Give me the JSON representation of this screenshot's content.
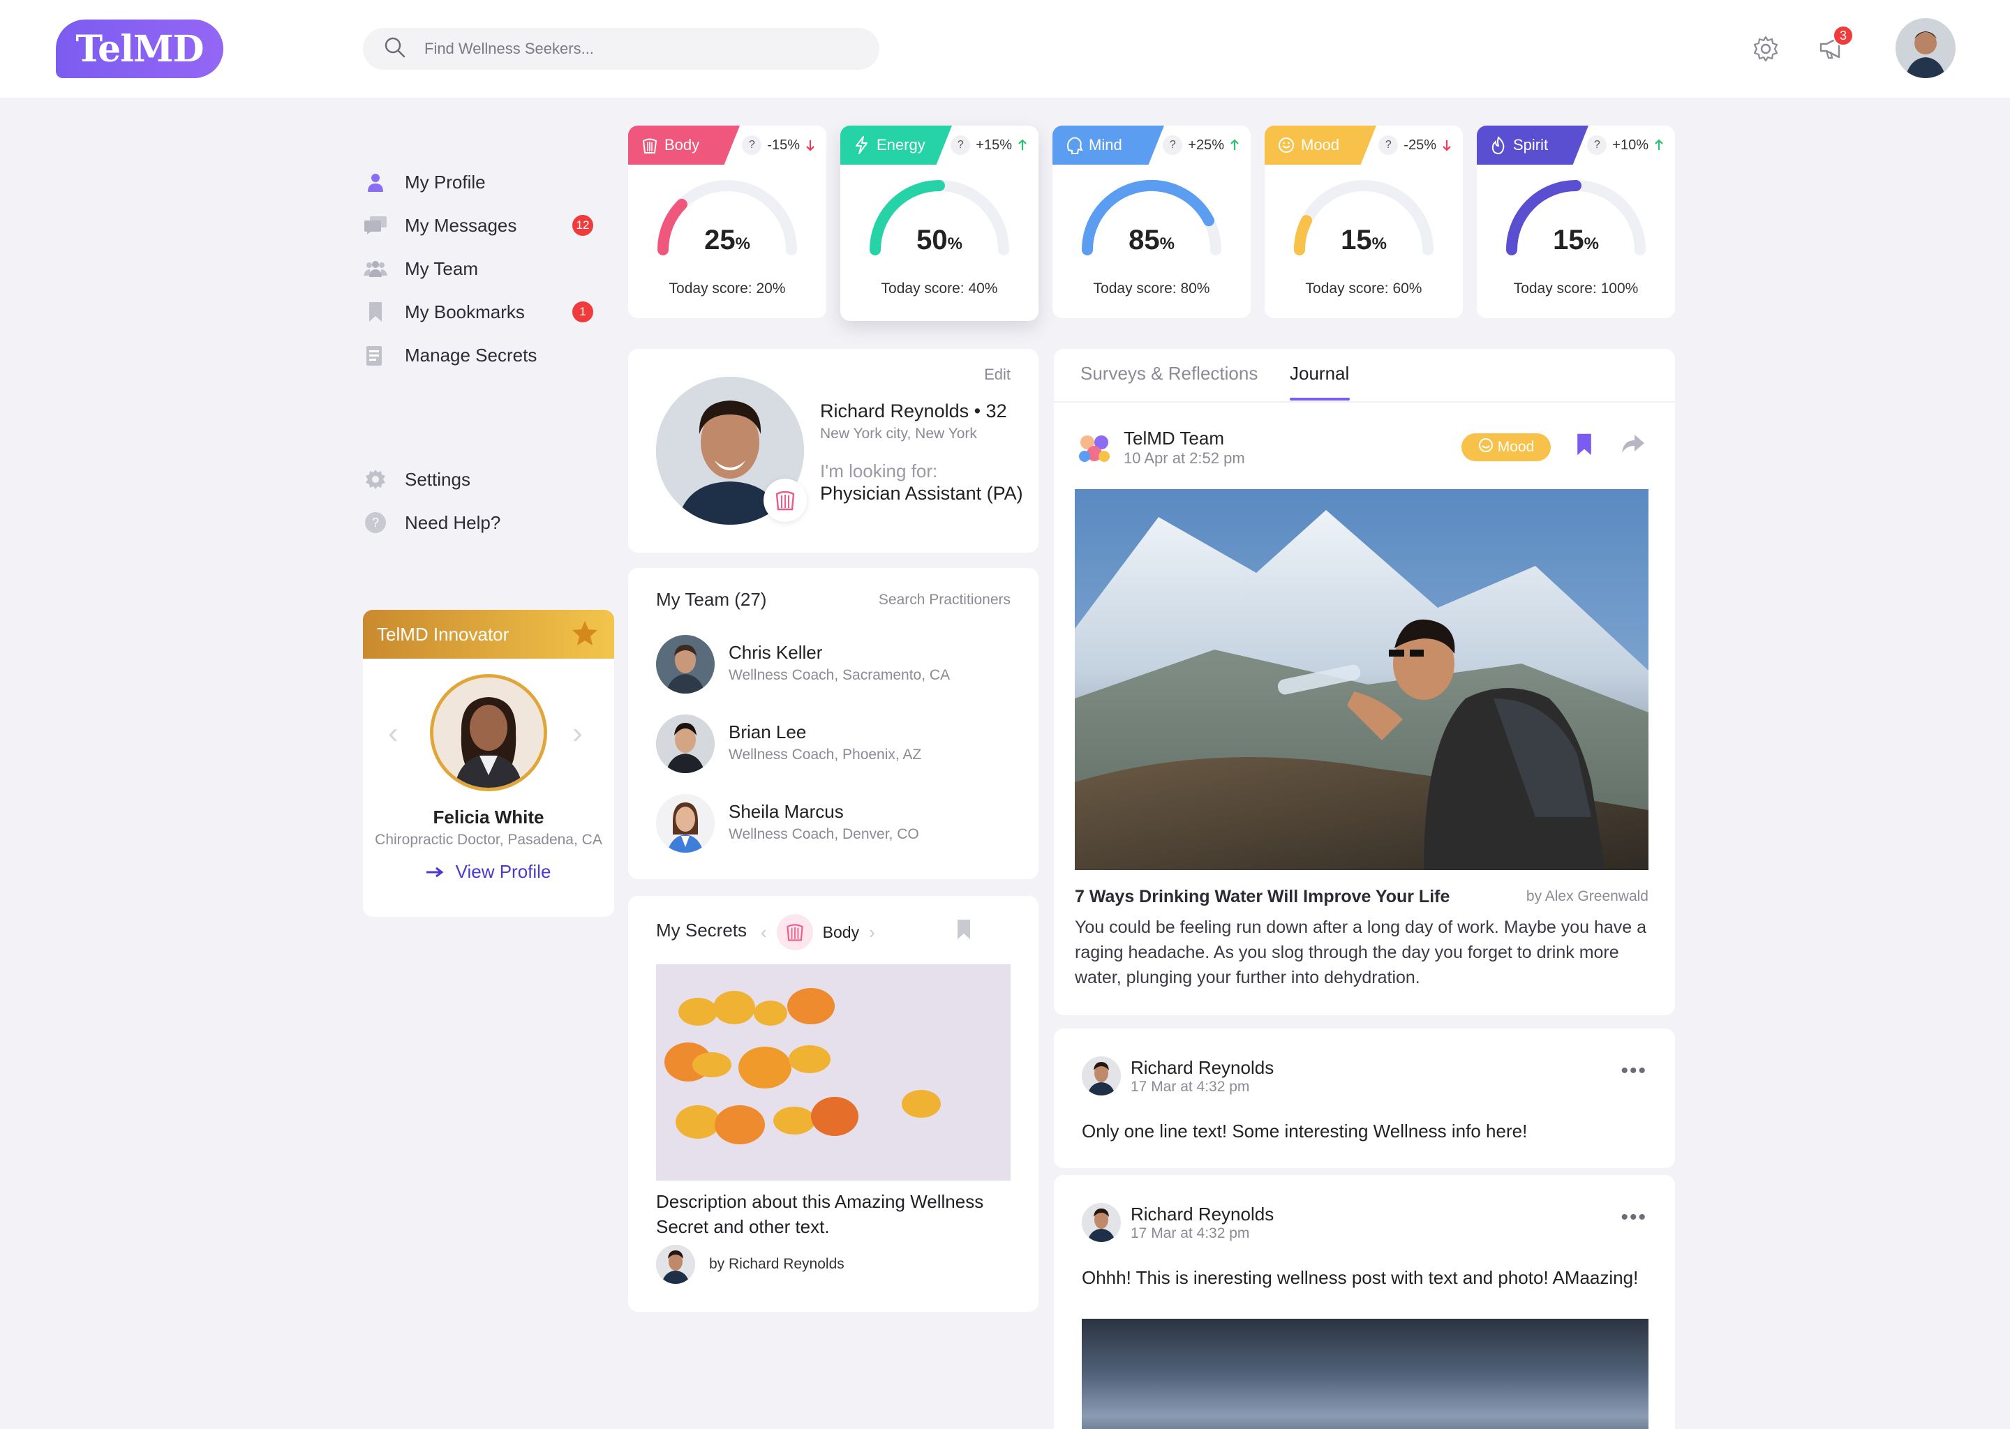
{
  "app": {
    "logo": "TelMD"
  },
  "header": {
    "search_placeholder": "Find Wellness Seekers...",
    "notification_count": "3"
  },
  "sidebar": {
    "items": [
      {
        "label": "My Profile",
        "icon": "user-icon",
        "badge": ""
      },
      {
        "label": "My Messages",
        "icon": "messages-icon",
        "badge": "12"
      },
      {
        "label": "My Team",
        "icon": "team-icon",
        "badge": ""
      },
      {
        "label": "My Bookmarks",
        "icon": "bookmark-icon",
        "badge": "1"
      },
      {
        "label": "Manage Secrets",
        "icon": "secrets-icon",
        "badge": ""
      }
    ],
    "secondary": [
      {
        "label": "Settings",
        "icon": "gear-icon"
      },
      {
        "label": "Need Help?",
        "icon": "help-icon"
      }
    ]
  },
  "innovator": {
    "title": "TelMD Innovator",
    "name": "Felicia White",
    "role": "Chiropractic Doctor, Pasadena, CA",
    "link": "View Profile"
  },
  "scores": [
    {
      "name": "Body",
      "delta": "-15%",
      "direction": "down",
      "value": "25",
      "unit": "%",
      "today_label": "Today score:",
      "today_value": "20%",
      "fraction": 0.25,
      "color": "#f0577c",
      "active": false
    },
    {
      "name": "Energy",
      "delta": "+15%",
      "direction": "up",
      "value": "50",
      "unit": "%",
      "today_label": "Today score:",
      "today_value": "40%",
      "fraction": 0.5,
      "color": "#26d3a6",
      "active": true
    },
    {
      "name": "Mind",
      "delta": "+25%",
      "direction": "up",
      "value": "85",
      "unit": "%",
      "today_label": "Today score:",
      "today_value": "80%",
      "fraction": 0.85,
      "color": "#5b9df0",
      "active": false
    },
    {
      "name": "Mood",
      "delta": "-25%",
      "direction": "down",
      "value": "15",
      "unit": "%",
      "today_label": "Today score:",
      "today_value": "60%",
      "fraction": 0.15,
      "color": "#f8c24a",
      "active": false
    },
    {
      "name": "Spirit",
      "delta": "+10%",
      "direction": "up",
      "value": "15",
      "unit": "%",
      "today_label": "Today score:",
      "today_value": "100%",
      "fraction": 0.5,
      "color": "#5a4fd1",
      "active": false
    }
  ],
  "profile": {
    "edit": "Edit",
    "name": "Richard Reynolds • 32",
    "location": "New York city, New York",
    "looking_label": "I'm looking for:",
    "looking_value": "Physician Assistant (PA)"
  },
  "team": {
    "title": "My Team  (27)",
    "search_link": "Search Practitioners",
    "members": [
      {
        "name": "Chris Keller",
        "role": "Wellness Coach, Sacramento, CA"
      },
      {
        "name": "Brian Lee",
        "role": "Wellness Coach, Phoenix, AZ"
      },
      {
        "name": "Sheila Marcus",
        "role": "Wellness Coach, Denver, CO"
      }
    ]
  },
  "secrets": {
    "title": "My Secrets",
    "category": "Body",
    "description": "Description about this Amazing Wellness Secret and other text.",
    "author": "by Richard Reynolds"
  },
  "feed": {
    "tabs": [
      "Surveys & Reflections",
      "Journal"
    ],
    "active_tab": "Journal",
    "main_post": {
      "author": "TelMD Team",
      "time": "10 Apr at 2:52 pm",
      "tag": "Mood",
      "title": "7 Ways Drinking Water Will Improve Your Life",
      "byline": "by Alex Greenwald",
      "body": "You could be feeling run down after a long day of work. Maybe you have a raging headache. As you slog through the day you forget to drink more water, plunging your further into dehydration."
    },
    "posts": [
      {
        "author": "Richard Reynolds",
        "time": "17 Mar at 4:32 pm",
        "text": "Only one line text! Some interesting Wellness info here!"
      },
      {
        "author": "Richard Reynolds",
        "time": "17 Mar at 4:32 pm",
        "text": "Ohhh! This is ineresting wellness post with text and photo! AMaazing!"
      }
    ]
  }
}
